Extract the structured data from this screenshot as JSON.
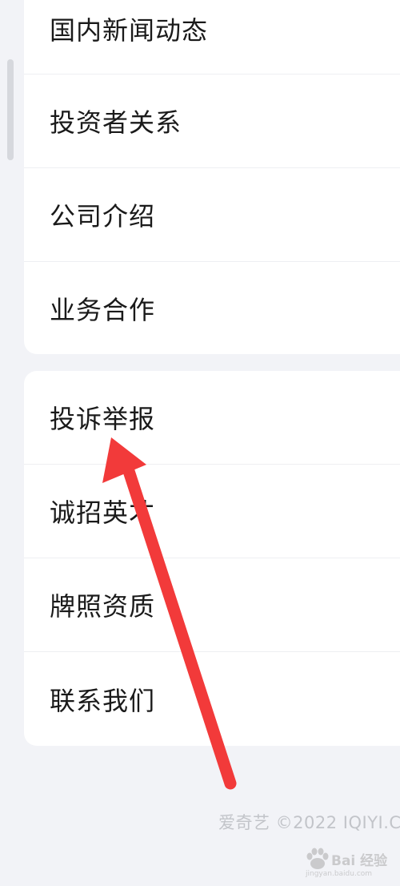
{
  "menu_group_1": [
    {
      "label": "国内新闻动态"
    },
    {
      "label": "投资者关系"
    },
    {
      "label": "公司介绍"
    },
    {
      "label": "业务合作"
    }
  ],
  "menu_group_2": [
    {
      "label": "投诉举报"
    },
    {
      "label": "诚招英才"
    },
    {
      "label": "牌照资质"
    },
    {
      "label": "联系我们"
    }
  ],
  "footer": {
    "copyright": "爱奇艺 ©2022 IQIYI.C"
  },
  "watermark": {
    "text": "Bai 经验",
    "sub": "jingyan.baidu.com"
  },
  "annotation": {
    "arrow_color": "#f23a3a",
    "arrow_icon": "red-arrow-annotation"
  }
}
